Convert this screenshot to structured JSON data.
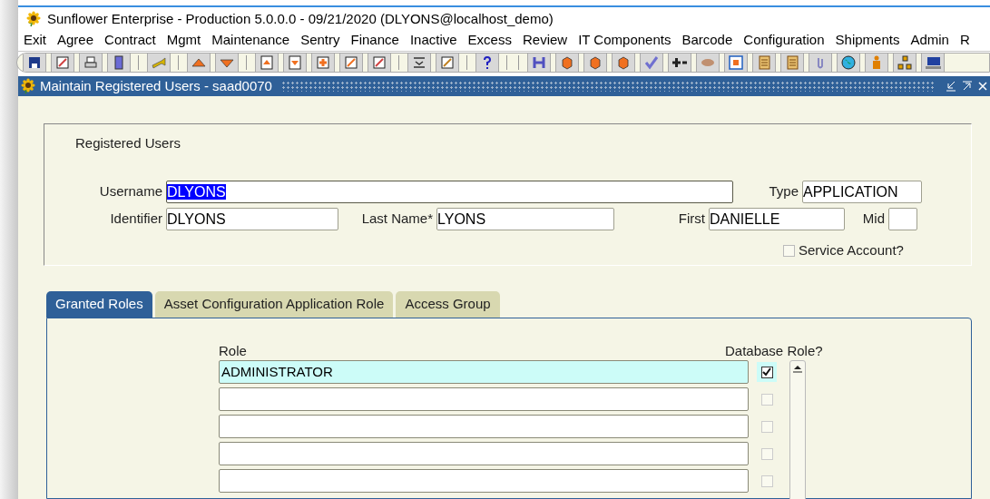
{
  "app_title": "Sunflower Enterprise - Production 5.0.0.0 - 09/21/2020 (DLYONS@localhost_demo)",
  "menu": [
    "Exit",
    "Agree",
    "Contract",
    "Mgmt",
    "Maintenance",
    "Sentry",
    "Finance",
    "Inactive",
    "Excess",
    "Review",
    "IT Components",
    "Barcode",
    "Configuration",
    "Shipments",
    "Admin",
    "R"
  ],
  "window": {
    "title": "Maintain Registered Users - saad0070"
  },
  "group": {
    "title": "Registered Users",
    "fields": [
      {
        "label": "Username",
        "value": "DLYONS",
        "selected": true
      },
      {
        "label": "Type",
        "value": "APPLICATION",
        "selected": false
      },
      {
        "label": "Identifier",
        "value": "DLYONS",
        "selected": false
      },
      {
        "label": "Last Name*",
        "value": "LYONS",
        "selected": false
      },
      {
        "label": "First",
        "value": "DANIELLE",
        "selected": false
      },
      {
        "label": "Mid",
        "selected": false
      }
    ],
    "service_account": {
      "label": "Service Account?",
      "checked": false
    }
  },
  "tabs": [
    {
      "label": "Granted Roles",
      "selected": true
    },
    {
      "label": "Asset Configuration Application Role",
      "selected": false
    },
    {
      "label": "Access Group",
      "selected": false
    }
  ],
  "roles": {
    "columns": [
      "Role",
      "Database Role?"
    ],
    "rows": [
      {
        "role": "ADMINISTRATOR",
        "database_role": true,
        "selected": true
      },
      {
        "database_role": false,
        "selected": false
      },
      {
        "database_role": false,
        "selected": false
      },
      {
        "database_role": false,
        "selected": false
      },
      {
        "database_role": false,
        "selected": false
      }
    ]
  }
}
